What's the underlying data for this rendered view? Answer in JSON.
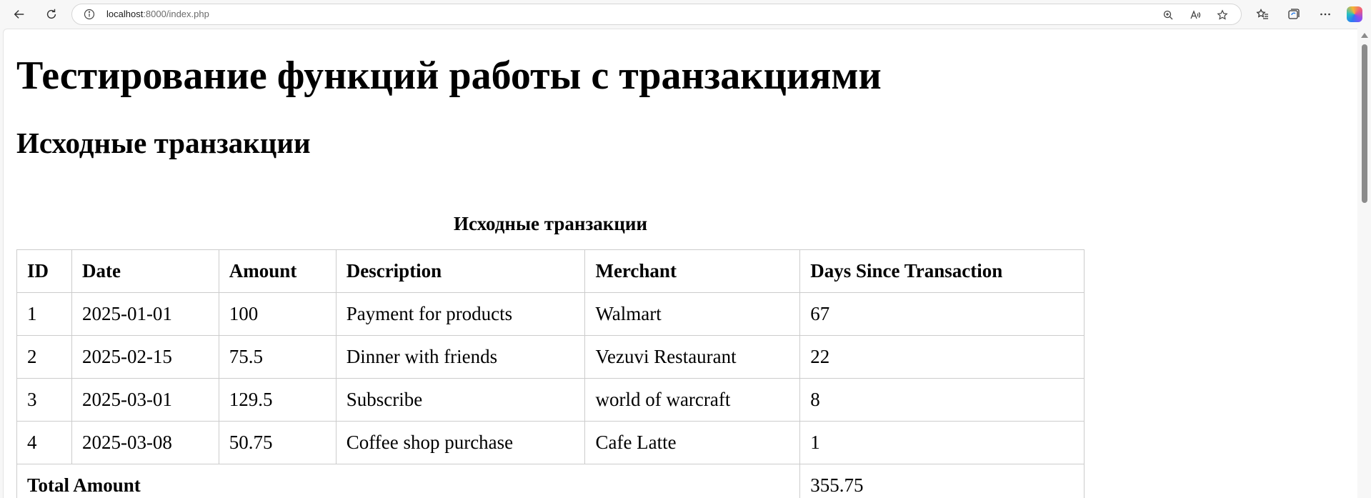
{
  "browser": {
    "url_host": "localhost",
    "url_rest": ":8000/index.php"
  },
  "page": {
    "heading1": "Тестирование функций работы с транзакциями",
    "heading2": "Исходные транзакции"
  },
  "table": {
    "caption": "Исходные транзакции",
    "headers": [
      "ID",
      "Date",
      "Amount",
      "Description",
      "Merchant",
      "Days Since Transaction"
    ],
    "rows": [
      [
        "1",
        "2025-01-01",
        "100",
        "Payment for products",
        "Walmart",
        "67"
      ],
      [
        "2",
        "2025-02-15",
        "75.5",
        "Dinner with friends",
        "Vezuvi Restaurant",
        "22"
      ],
      [
        "3",
        "2025-03-01",
        "129.5",
        "Subscribe",
        "world of warcraft",
        "8"
      ],
      [
        "4",
        "2025-03-08",
        "50.75",
        "Coffee shop purchase",
        "Cafe Latte",
        "1"
      ]
    ],
    "total_label": "Total Amount",
    "total_value": "355.75"
  },
  "icons": {
    "back": "back-arrow-icon",
    "refresh": "refresh-icon",
    "info": "info-icon",
    "zoom": "zoom-icon",
    "read_aloud": "read-aloud-icon",
    "favorite": "star-icon",
    "favorites": "favorites-icon",
    "collections": "collections-icon",
    "more": "more-icon",
    "copilot": "copilot-icon"
  }
}
